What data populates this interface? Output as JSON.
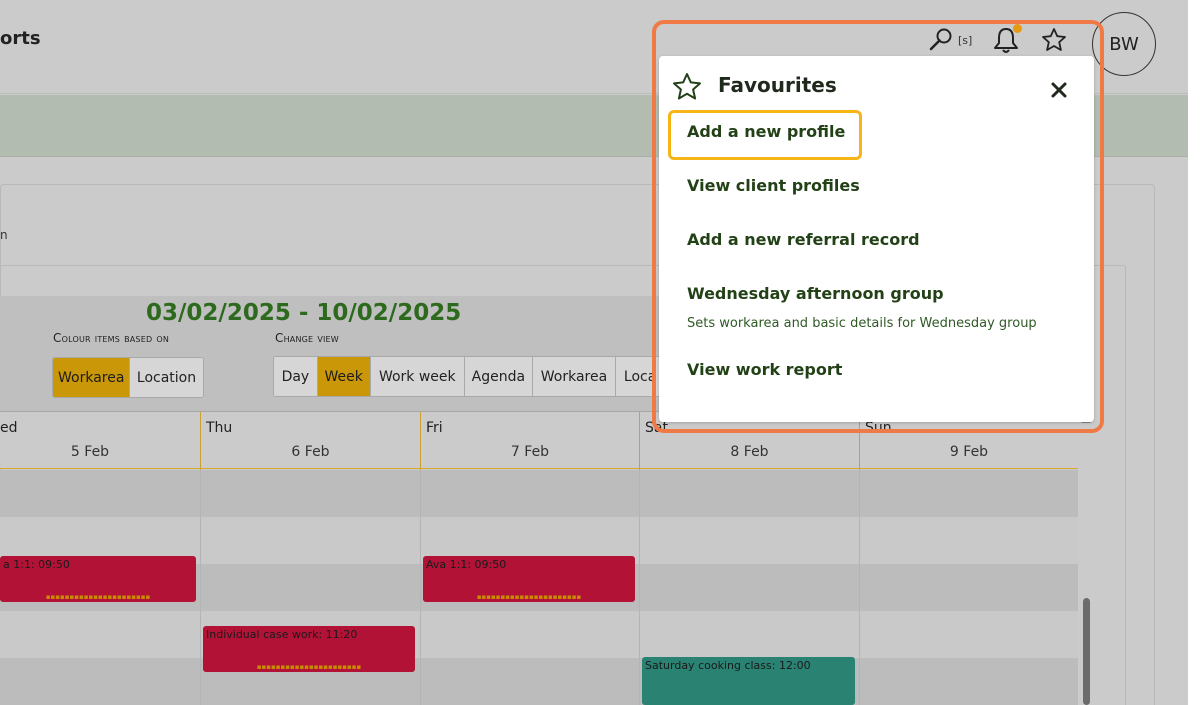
{
  "header": {
    "brand_partial": "orts",
    "search_shortcut": "[s]",
    "avatar_initials": "BW"
  },
  "panel": {
    "partial_letter": "n"
  },
  "toolbar": {
    "date_range": "03/02/2025 - 10/02/2025",
    "colour_label": "Colour items based on",
    "colour_options": [
      "Workarea",
      "Location"
    ],
    "colour_selected": "Workarea",
    "view_label": "Change view",
    "view_options": [
      "Day",
      "Week",
      "Work week",
      "Agenda",
      "Workarea",
      "Loca"
    ],
    "view_selected": "Week"
  },
  "calendar": {
    "days": [
      {
        "dow": "ed",
        "date": "5 Feb"
      },
      {
        "dow": "Thu",
        "date": "6 Feb"
      },
      {
        "dow": "Fri",
        "date": "7 Feb"
      },
      {
        "dow": "Sat",
        "date": "8 Feb"
      },
      {
        "dow": "Sun",
        "date": "9 Feb"
      }
    ],
    "events": [
      {
        "title": "a 1:1: 09:50",
        "color": "#b31237"
      },
      {
        "title": "Individual case work: 11:20",
        "color": "#b31237"
      },
      {
        "title": "Ava 1:1: 09:50",
        "color": "#b31237"
      },
      {
        "title": "Saturday cooking class: 12:00",
        "color": "#2a8272"
      }
    ]
  },
  "favourites": {
    "title": "Favourites",
    "items": [
      {
        "label": "Add a new profile"
      },
      {
        "label": "View client profiles"
      },
      {
        "label": "Add a new referral record"
      },
      {
        "label": "Wednesday afternoon group",
        "description": "Sets workarea and basic details for Wednesday group"
      },
      {
        "label": "View work report"
      }
    ]
  },
  "colors": {
    "accent_orange": "#f07a46",
    "focus_yellow": "#f6b417",
    "active_button": "#c99708",
    "notification_dot": "#e59a13",
    "date_green": "#2d6a1e"
  }
}
